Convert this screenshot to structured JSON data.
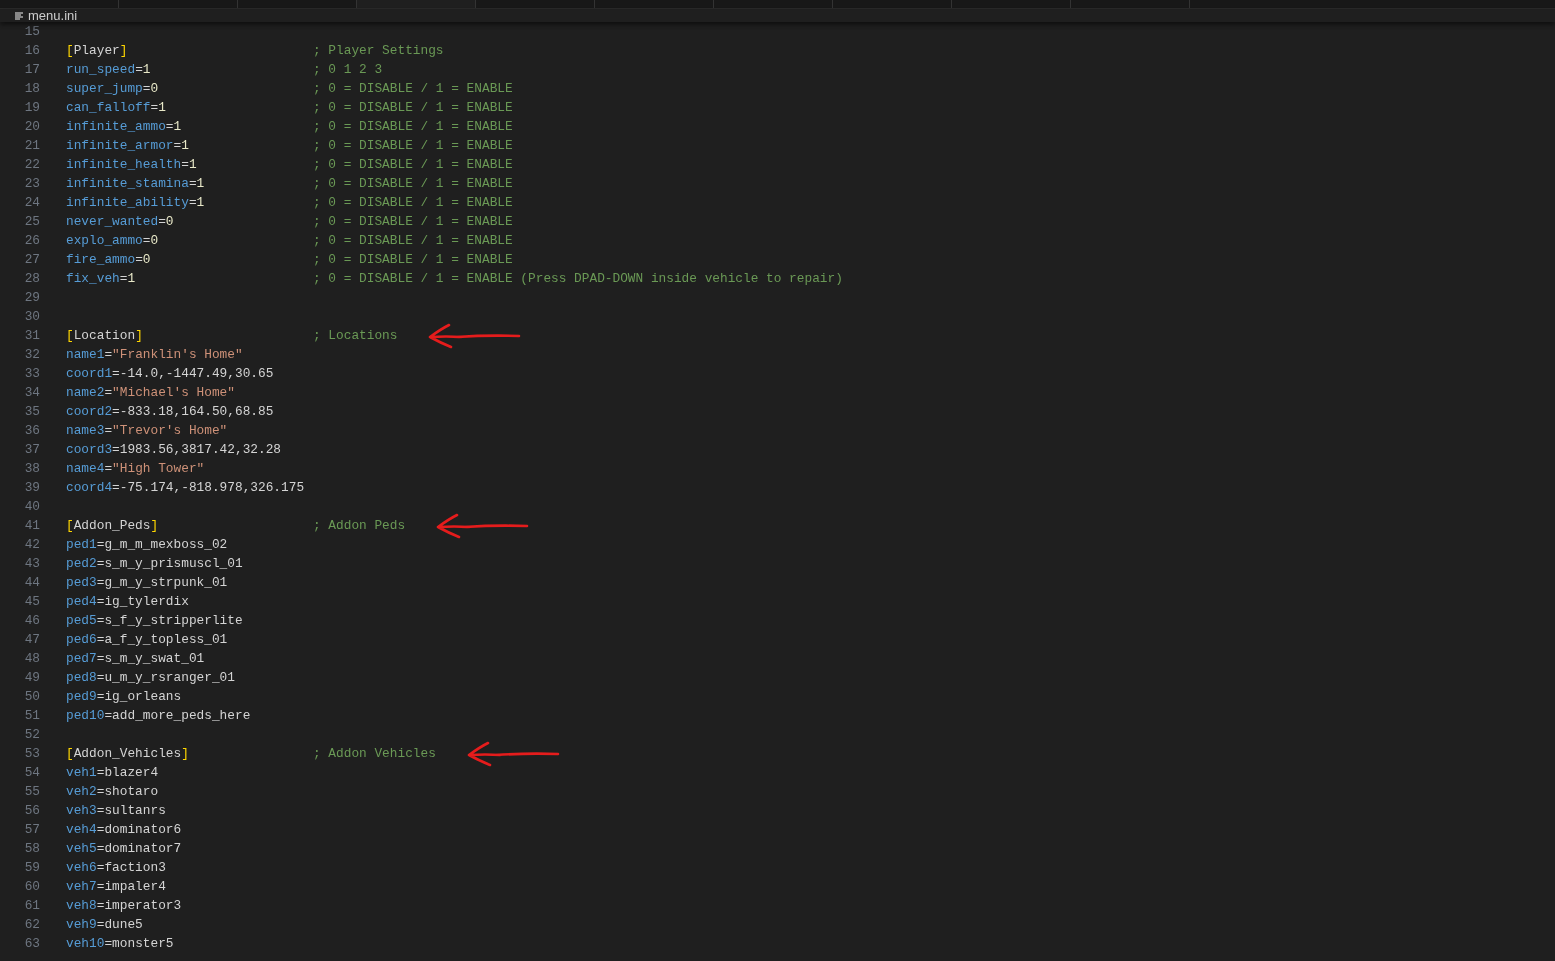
{
  "breadcrumb": {
    "file": "menu.ini"
  },
  "lines": [
    {
      "number": "15"
    },
    {
      "number": "16",
      "tokens": [
        {
          "kind": "bracket",
          "text": "["
        },
        {
          "kind": "section",
          "text": "Player"
        },
        {
          "kind": "bracket",
          "text": "]"
        }
      ],
      "comment": "; Player Settings"
    },
    {
      "number": "17",
      "tokens": [
        {
          "kind": "key",
          "text": "run_speed"
        },
        {
          "kind": "op",
          "text": "="
        },
        {
          "kind": "number",
          "text": "1"
        }
      ],
      "comment": "; 0 1 2 3"
    },
    {
      "number": "18",
      "tokens": [
        {
          "kind": "key",
          "text": "super_jump"
        },
        {
          "kind": "op",
          "text": "="
        },
        {
          "kind": "number",
          "text": "0"
        }
      ],
      "comment": "; 0 = DISABLE / 1 = ENABLE"
    },
    {
      "number": "19",
      "tokens": [
        {
          "kind": "key",
          "text": "can_falloff"
        },
        {
          "kind": "op",
          "text": "="
        },
        {
          "kind": "number",
          "text": "1"
        }
      ],
      "comment": "; 0 = DISABLE / 1 = ENABLE"
    },
    {
      "number": "20",
      "tokens": [
        {
          "kind": "key",
          "text": "infinite_ammo"
        },
        {
          "kind": "op",
          "text": "="
        },
        {
          "kind": "number",
          "text": "1"
        }
      ],
      "comment": "; 0 = DISABLE / 1 = ENABLE"
    },
    {
      "number": "21",
      "tokens": [
        {
          "kind": "key",
          "text": "infinite_armor"
        },
        {
          "kind": "op",
          "text": "="
        },
        {
          "kind": "number",
          "text": "1"
        }
      ],
      "comment": "; 0 = DISABLE / 1 = ENABLE"
    },
    {
      "number": "22",
      "tokens": [
        {
          "kind": "key",
          "text": "infinite_health"
        },
        {
          "kind": "op",
          "text": "="
        },
        {
          "kind": "number",
          "text": "1"
        }
      ],
      "comment": "; 0 = DISABLE / 1 = ENABLE"
    },
    {
      "number": "23",
      "tokens": [
        {
          "kind": "key",
          "text": "infinite_stamina"
        },
        {
          "kind": "op",
          "text": "="
        },
        {
          "kind": "number",
          "text": "1"
        }
      ],
      "comment": "; 0 = DISABLE / 1 = ENABLE"
    },
    {
      "number": "24",
      "tokens": [
        {
          "kind": "key",
          "text": "infinite_ability"
        },
        {
          "kind": "op",
          "text": "="
        },
        {
          "kind": "number",
          "text": "1"
        }
      ],
      "comment": "; 0 = DISABLE / 1 = ENABLE"
    },
    {
      "number": "25",
      "tokens": [
        {
          "kind": "key",
          "text": "never_wanted"
        },
        {
          "kind": "op",
          "text": "="
        },
        {
          "kind": "number",
          "text": "0"
        }
      ],
      "comment": "; 0 = DISABLE / 1 = ENABLE"
    },
    {
      "number": "26",
      "tokens": [
        {
          "kind": "key",
          "text": "explo_ammo"
        },
        {
          "kind": "op",
          "text": "="
        },
        {
          "kind": "number",
          "text": "0"
        }
      ],
      "comment": "; 0 = DISABLE / 1 = ENABLE"
    },
    {
      "number": "27",
      "tokens": [
        {
          "kind": "key",
          "text": "fire_ammo"
        },
        {
          "kind": "op",
          "text": "="
        },
        {
          "kind": "number",
          "text": "0"
        }
      ],
      "comment": "; 0 = DISABLE / 1 = ENABLE"
    },
    {
      "number": "28",
      "tokens": [
        {
          "kind": "key",
          "text": "fix_veh"
        },
        {
          "kind": "op",
          "text": "="
        },
        {
          "kind": "number",
          "text": "1"
        }
      ],
      "comment": "; 0 = DISABLE / 1 = ENABLE (Press DPAD-DOWN inside vehicle to repair)"
    },
    {
      "number": "29"
    },
    {
      "number": "30"
    },
    {
      "number": "31",
      "tokens": [
        {
          "kind": "bracket",
          "text": "["
        },
        {
          "kind": "section",
          "text": "Location"
        },
        {
          "kind": "bracket",
          "text": "]"
        }
      ],
      "comment": "; Locations",
      "arrow_marked": true
    },
    {
      "number": "32",
      "tokens": [
        {
          "kind": "key",
          "text": "name1"
        },
        {
          "kind": "op",
          "text": "="
        },
        {
          "kind": "string",
          "text": "\"Franklin's Home\""
        }
      ]
    },
    {
      "number": "33",
      "tokens": [
        {
          "kind": "key",
          "text": "coord1"
        },
        {
          "kind": "op",
          "text": "="
        },
        {
          "kind": "plain",
          "text": "-14.0,-1447.49,30.65"
        }
      ]
    },
    {
      "number": "34",
      "tokens": [
        {
          "kind": "key",
          "text": "name2"
        },
        {
          "kind": "op",
          "text": "="
        },
        {
          "kind": "string",
          "text": "\"Michael's Home\""
        }
      ]
    },
    {
      "number": "35",
      "tokens": [
        {
          "kind": "key",
          "text": "coord2"
        },
        {
          "kind": "op",
          "text": "="
        },
        {
          "kind": "plain",
          "text": "-833.18,164.50,68.85"
        }
      ]
    },
    {
      "number": "36",
      "tokens": [
        {
          "kind": "key",
          "text": "name3"
        },
        {
          "kind": "op",
          "text": "="
        },
        {
          "kind": "string",
          "text": "\"Trevor's Home\""
        }
      ]
    },
    {
      "number": "37",
      "tokens": [
        {
          "kind": "key",
          "text": "coord3"
        },
        {
          "kind": "op",
          "text": "="
        },
        {
          "kind": "plain",
          "text": "1983.56,3817.42,32.28"
        }
      ]
    },
    {
      "number": "38",
      "tokens": [
        {
          "kind": "key",
          "text": "name4"
        },
        {
          "kind": "op",
          "text": "="
        },
        {
          "kind": "string",
          "text": "\"High Tower\""
        }
      ]
    },
    {
      "number": "39",
      "tokens": [
        {
          "kind": "key",
          "text": "coord4"
        },
        {
          "kind": "op",
          "text": "="
        },
        {
          "kind": "plain",
          "text": "-75.174,-818.978,326.175"
        }
      ]
    },
    {
      "number": "40"
    },
    {
      "number": "41",
      "tokens": [
        {
          "kind": "bracket",
          "text": "["
        },
        {
          "kind": "section",
          "text": "Addon_Peds"
        },
        {
          "kind": "bracket",
          "text": "]"
        }
      ],
      "comment": "; Addon Peds",
      "arrow_marked": true
    },
    {
      "number": "42",
      "tokens": [
        {
          "kind": "key",
          "text": "ped1"
        },
        {
          "kind": "op",
          "text": "="
        },
        {
          "kind": "plain",
          "text": "g_m_m_mexboss_02"
        }
      ]
    },
    {
      "number": "43",
      "tokens": [
        {
          "kind": "key",
          "text": "ped2"
        },
        {
          "kind": "op",
          "text": "="
        },
        {
          "kind": "plain",
          "text": "s_m_y_prismuscl_01"
        }
      ]
    },
    {
      "number": "44",
      "tokens": [
        {
          "kind": "key",
          "text": "ped3"
        },
        {
          "kind": "op",
          "text": "="
        },
        {
          "kind": "plain",
          "text": "g_m_y_strpunk_01"
        }
      ]
    },
    {
      "number": "45",
      "tokens": [
        {
          "kind": "key",
          "text": "ped4"
        },
        {
          "kind": "op",
          "text": "="
        },
        {
          "kind": "plain",
          "text": "ig_tylerdix"
        }
      ]
    },
    {
      "number": "46",
      "tokens": [
        {
          "kind": "key",
          "text": "ped5"
        },
        {
          "kind": "op",
          "text": "="
        },
        {
          "kind": "plain",
          "text": "s_f_y_stripperlite"
        }
      ]
    },
    {
      "number": "47",
      "tokens": [
        {
          "kind": "key",
          "text": "ped6"
        },
        {
          "kind": "op",
          "text": "="
        },
        {
          "kind": "plain",
          "text": "a_f_y_topless_01"
        }
      ]
    },
    {
      "number": "48",
      "tokens": [
        {
          "kind": "key",
          "text": "ped7"
        },
        {
          "kind": "op",
          "text": "="
        },
        {
          "kind": "plain",
          "text": "s_m_y_swat_01"
        }
      ]
    },
    {
      "number": "49",
      "tokens": [
        {
          "kind": "key",
          "text": "ped8"
        },
        {
          "kind": "op",
          "text": "="
        },
        {
          "kind": "plain",
          "text": "u_m_y_rsranger_01"
        }
      ]
    },
    {
      "number": "50",
      "tokens": [
        {
          "kind": "key",
          "text": "ped9"
        },
        {
          "kind": "op",
          "text": "="
        },
        {
          "kind": "plain",
          "text": "ig_orleans"
        }
      ]
    },
    {
      "number": "51",
      "tokens": [
        {
          "kind": "key",
          "text": "ped10"
        },
        {
          "kind": "op",
          "text": "="
        },
        {
          "kind": "plain",
          "text": "add_more_peds_here"
        }
      ]
    },
    {
      "number": "52"
    },
    {
      "number": "53",
      "tokens": [
        {
          "kind": "bracket",
          "text": "["
        },
        {
          "kind": "section",
          "text": "Addon_Vehicles"
        },
        {
          "kind": "bracket",
          "text": "]"
        }
      ],
      "comment": "; Addon Vehicles",
      "arrow_marked": true
    },
    {
      "number": "54",
      "tokens": [
        {
          "kind": "key",
          "text": "veh1"
        },
        {
          "kind": "op",
          "text": "="
        },
        {
          "kind": "plain",
          "text": "blazer4"
        }
      ]
    },
    {
      "number": "55",
      "tokens": [
        {
          "kind": "key",
          "text": "veh2"
        },
        {
          "kind": "op",
          "text": "="
        },
        {
          "kind": "plain",
          "text": "shotaro"
        }
      ]
    },
    {
      "number": "56",
      "tokens": [
        {
          "kind": "key",
          "text": "veh3"
        },
        {
          "kind": "op",
          "text": "="
        },
        {
          "kind": "plain",
          "text": "sultanrs"
        }
      ]
    },
    {
      "number": "57",
      "tokens": [
        {
          "kind": "key",
          "text": "veh4"
        },
        {
          "kind": "op",
          "text": "="
        },
        {
          "kind": "plain",
          "text": "dominator6"
        }
      ]
    },
    {
      "number": "58",
      "tokens": [
        {
          "kind": "key",
          "text": "veh5"
        },
        {
          "kind": "op",
          "text": "="
        },
        {
          "kind": "plain",
          "text": "dominator7"
        }
      ]
    },
    {
      "number": "59",
      "tokens": [
        {
          "kind": "key",
          "text": "veh6"
        },
        {
          "kind": "op",
          "text": "="
        },
        {
          "kind": "plain",
          "text": "faction3"
        }
      ]
    },
    {
      "number": "60",
      "tokens": [
        {
          "kind": "key",
          "text": "veh7"
        },
        {
          "kind": "op",
          "text": "="
        },
        {
          "kind": "plain",
          "text": "impaler4"
        }
      ]
    },
    {
      "number": "61",
      "tokens": [
        {
          "kind": "key",
          "text": "veh8"
        },
        {
          "kind": "op",
          "text": "="
        },
        {
          "kind": "plain",
          "text": "imperator3"
        }
      ]
    },
    {
      "number": "62",
      "tokens": [
        {
          "kind": "key",
          "text": "veh9"
        },
        {
          "kind": "op",
          "text": "="
        },
        {
          "kind": "plain",
          "text": "dune5"
        }
      ]
    },
    {
      "number": "63",
      "tokens": [
        {
          "kind": "key",
          "text": "veh10"
        },
        {
          "kind": "op",
          "text": "="
        },
        {
          "kind": "plain",
          "text": "monster5"
        }
      ]
    }
  ]
}
